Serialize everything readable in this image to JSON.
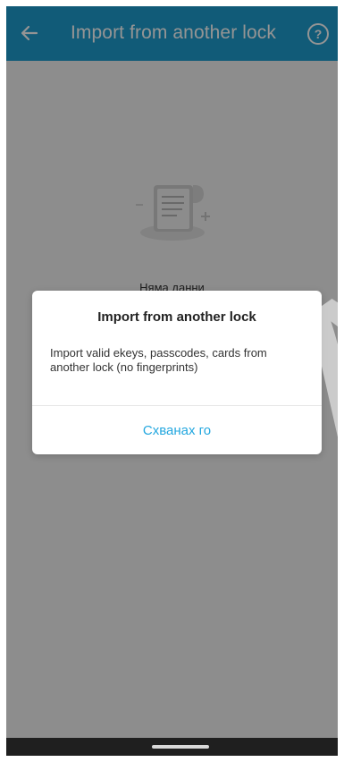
{
  "app_bar": {
    "title": "Import from another lock",
    "back_icon": "back-arrow-icon",
    "help_icon": "help-circle-icon",
    "help_glyph": "?",
    "background": "#1E9ECF"
  },
  "empty_state": {
    "illustration_icon": "document-list-icon",
    "text": "Няма данни"
  },
  "dialog": {
    "title": "Import from another lock",
    "message": "Import valid ekeys, passcodes, cards from another lock (no fingerprints)",
    "button_label": "Схванах го",
    "button_color": "#23A7DF"
  },
  "system_nav": {
    "home_indicator_icon": "home-indicator-icon"
  },
  "watermark": {
    "text": "A"
  }
}
